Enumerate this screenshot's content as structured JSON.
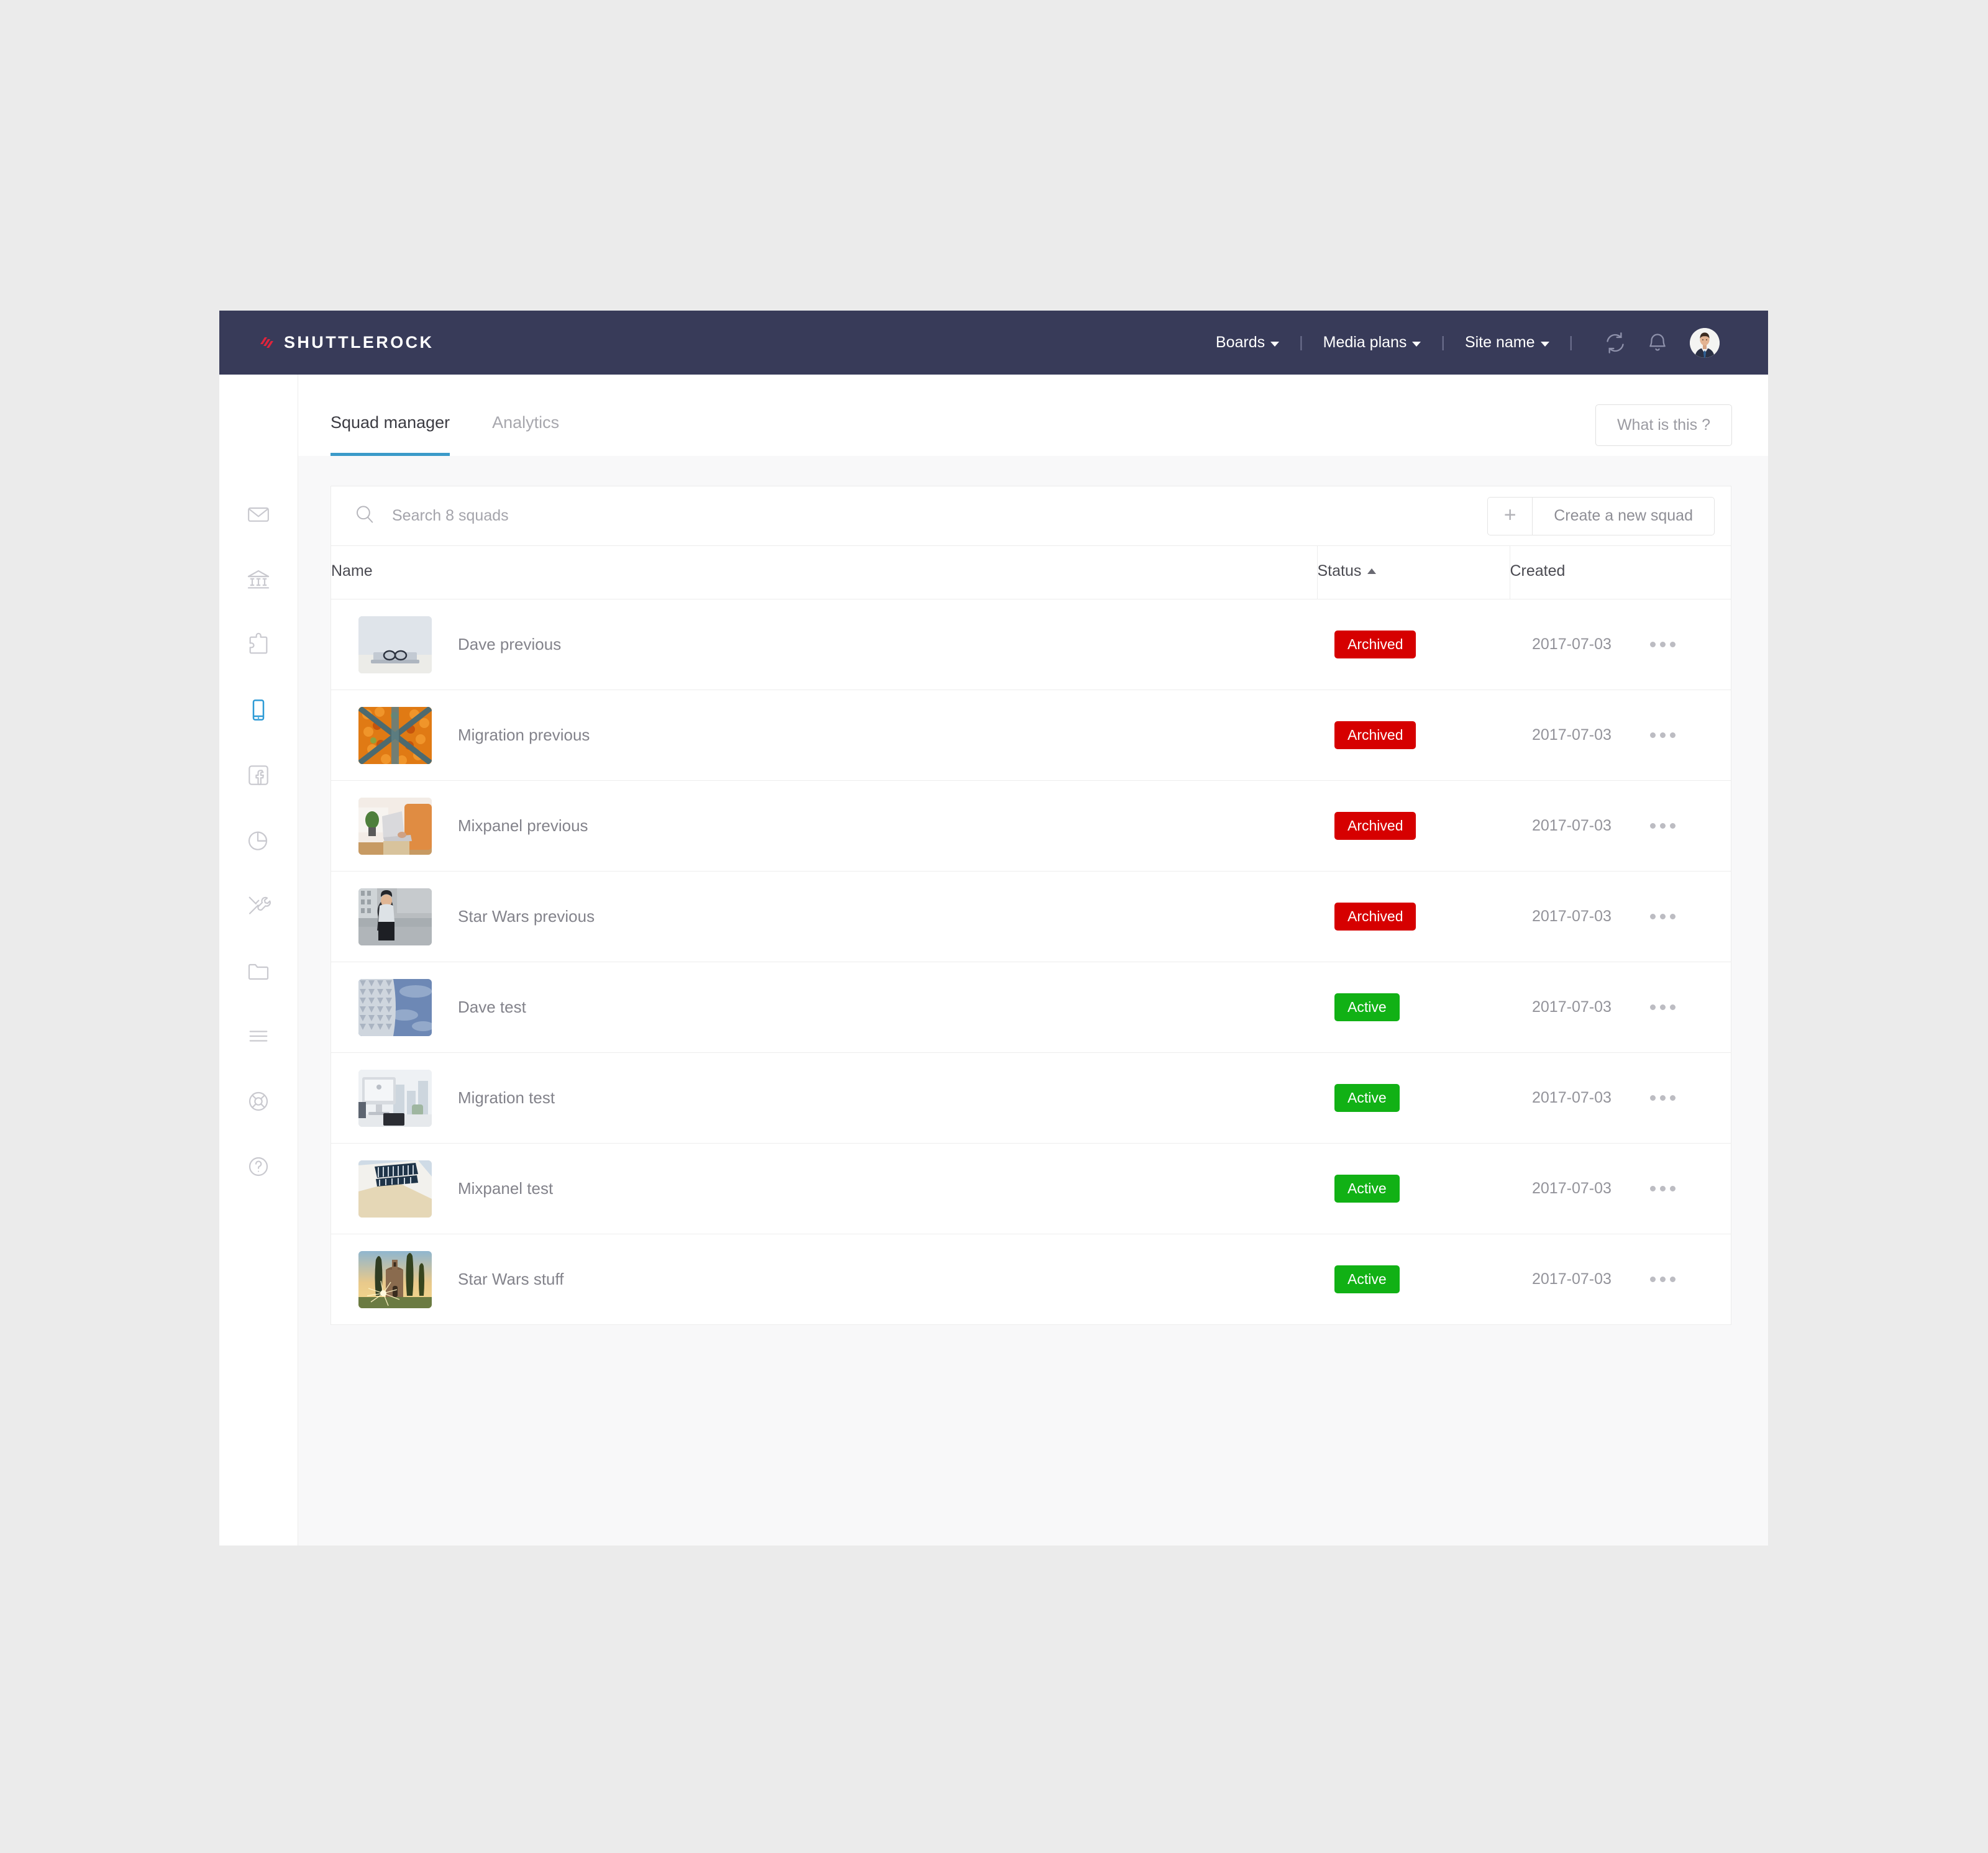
{
  "topbar": {
    "brand": "SHUTTLEROCK",
    "brand_mark_color": "#e0243c",
    "bar_color": "#383b59",
    "nav": [
      {
        "label": "Boards",
        "has_caret": true
      },
      {
        "label": "Media plans",
        "has_caret": true
      },
      {
        "label": "Site name",
        "has_caret": true
      }
    ],
    "separator": "|",
    "icons": [
      {
        "name": "refresh-icon"
      },
      {
        "name": "bell-icon"
      }
    ],
    "avatar": {
      "name": "user-avatar",
      "alt": "User profile photo"
    }
  },
  "tabs": [
    {
      "label": "Squad manager",
      "active": true
    },
    {
      "label": "Analytics",
      "active": false
    }
  ],
  "tab_accent_color": "#3b9ac9",
  "help_button": {
    "label": "What is this ?"
  },
  "search": {
    "placeholder": "Search 8 squads",
    "value": "",
    "icon": "search-icon"
  },
  "create_button": {
    "plus": "+",
    "label": "Create a new squad"
  },
  "table": {
    "columns": [
      {
        "key": "name",
        "label": "Name",
        "sorted": false
      },
      {
        "key": "status",
        "label": "Status",
        "sorted": true,
        "sort_direction": "asc"
      },
      {
        "key": "created",
        "label": "Created",
        "sorted": false
      }
    ],
    "rows": [
      {
        "name": "Dave previous",
        "status": "Archived",
        "status_type": "archived",
        "created": "2017-07-03",
        "thumb": "laptop-glasses"
      },
      {
        "name": "Migration previous",
        "status": "Archived",
        "status_type": "archived",
        "created": "2017-07-03",
        "thumb": "orange-fruit-market"
      },
      {
        "name": "Mixpanel previous",
        "status": "Archived",
        "status_type": "archived",
        "created": "2017-07-03",
        "thumb": "person-laptop-orange-chair"
      },
      {
        "name": "Star Wars previous",
        "status": "Archived",
        "status_type": "archived",
        "created": "2017-07-03",
        "thumb": "woman-on-steps"
      },
      {
        "name": "Dave test",
        "status": "Active",
        "status_type": "active",
        "created": "2017-07-03",
        "thumb": "geometric-building-sky"
      },
      {
        "name": "Migration test",
        "status": "Active",
        "status_type": "active",
        "created": "2017-07-03",
        "thumb": "imac-city-window"
      },
      {
        "name": "Mixpanel test",
        "status": "Active",
        "status_type": "active",
        "created": "2017-07-03",
        "thumb": "white-modern-building"
      },
      {
        "name": "Star Wars stuff",
        "status": "Active",
        "status_type": "active",
        "created": "2017-07-03",
        "thumb": "chapel-sunset"
      }
    ],
    "row_action_label": "•••"
  },
  "status_colors": {
    "archived": "#d60000",
    "active": "#11b115"
  },
  "sidebar": {
    "items": [
      {
        "name": "mail-icon",
        "active": false
      },
      {
        "name": "bank-icon",
        "active": false
      },
      {
        "name": "puzzle-icon",
        "active": false
      },
      {
        "name": "mobile-icon",
        "active": true
      },
      {
        "name": "facebook-icon",
        "active": false
      },
      {
        "name": "pie-chart-icon",
        "active": false
      },
      {
        "name": "tools-icon",
        "active": false
      },
      {
        "name": "folder-icon",
        "active": false
      },
      {
        "name": "list-icon",
        "active": false
      },
      {
        "name": "lifering-icon",
        "active": false
      },
      {
        "name": "help-icon",
        "active": false
      }
    ],
    "active_color": "#2e9bd6",
    "idle_color": "#c9c9cf"
  }
}
